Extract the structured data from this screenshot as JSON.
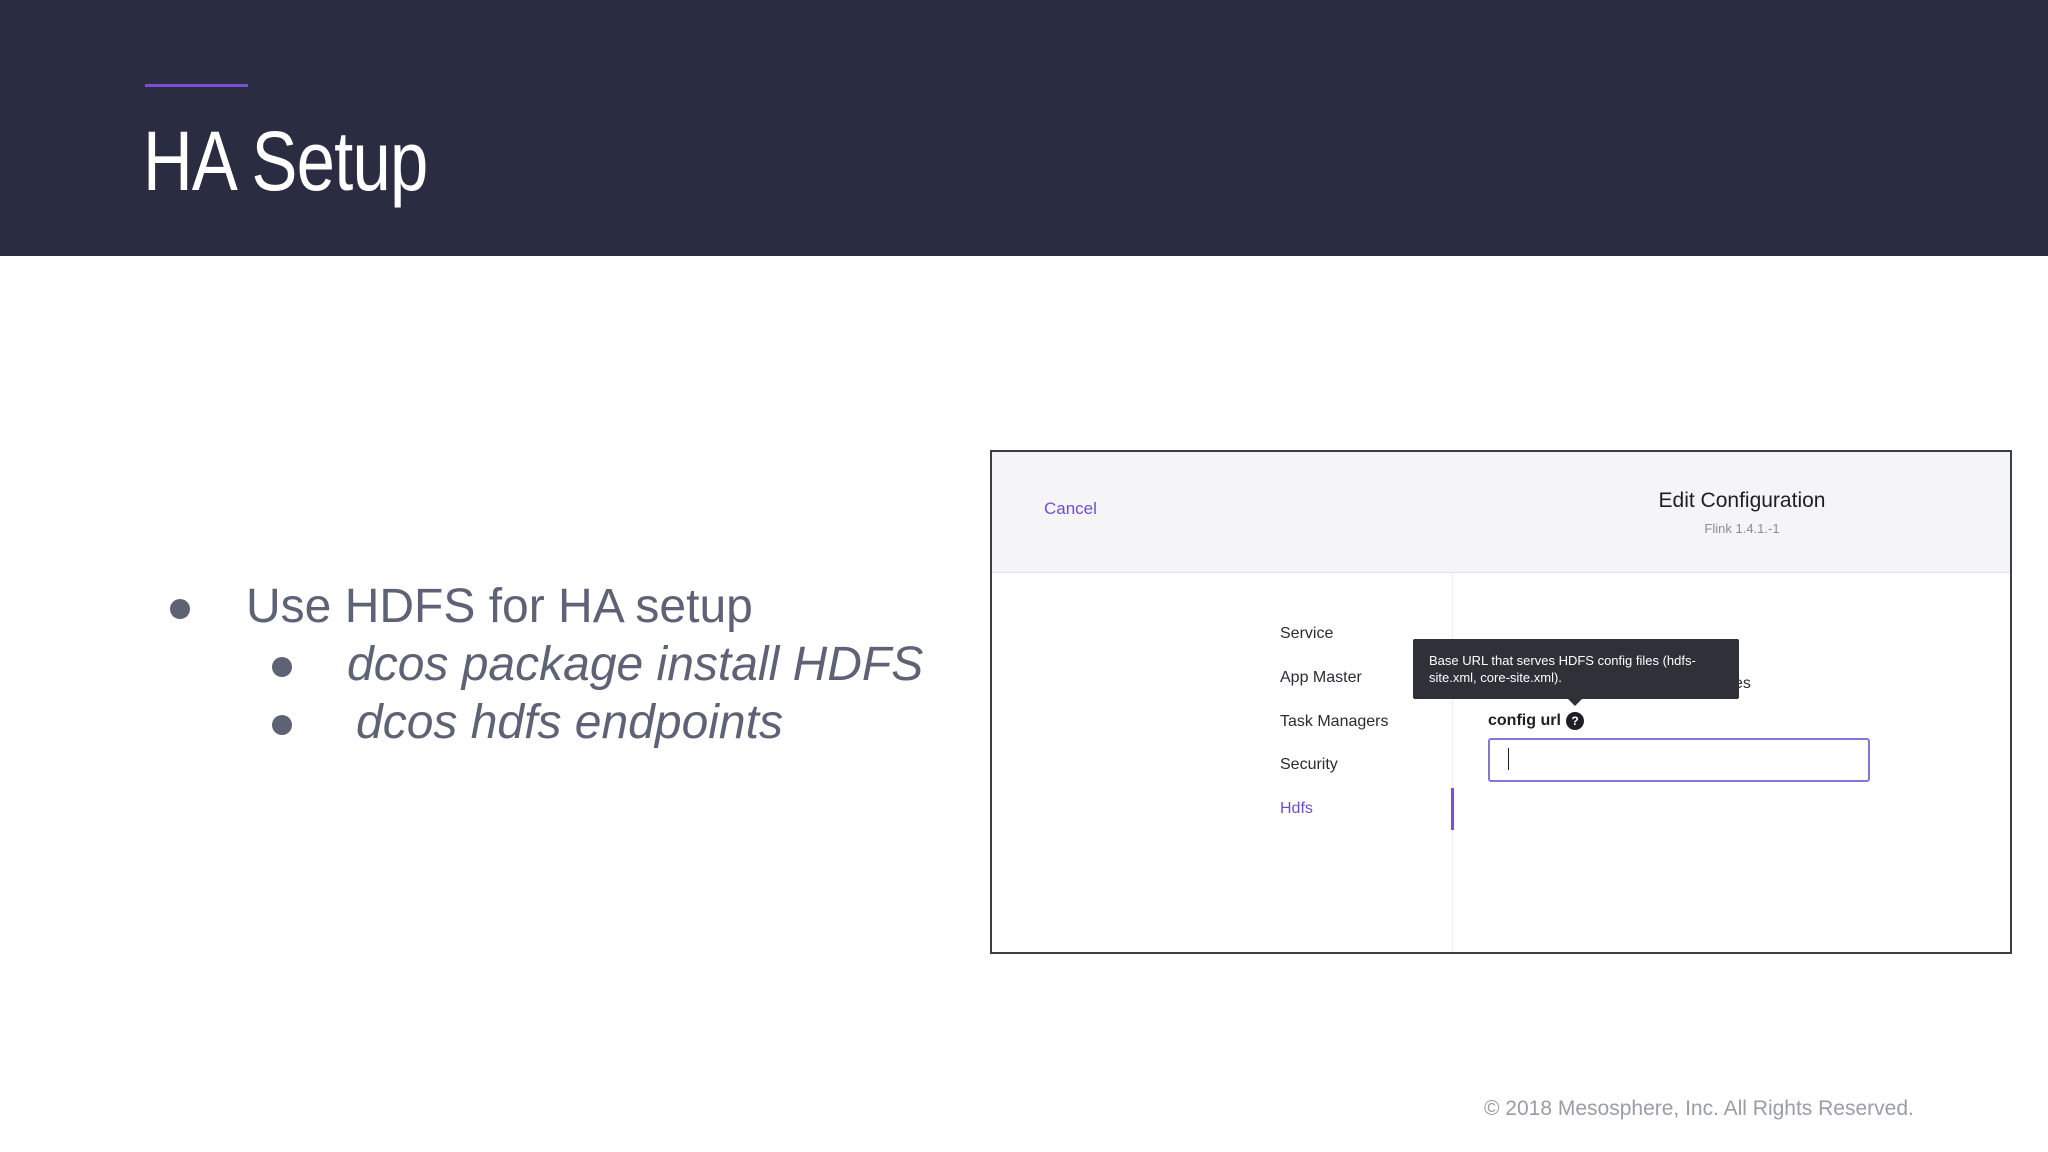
{
  "slide": {
    "title": "HA Setup",
    "bullets": [
      "Use HDFS for HA setup",
      "dcos package install HDFS",
      " dcos hdfs endpoints"
    ],
    "copyright": "© 2018 Mesosphere, Inc. All Rights Reserved."
  },
  "colors": {
    "header_bg": "#2a2d41",
    "accent": "#7a4fd6",
    "link": "#6b4fd1"
  },
  "modal": {
    "cancel_label": "Cancel",
    "title": "Edit Configuration",
    "subtitle": "Flink 1.4.1.-1",
    "nav": [
      {
        "label": "Service"
      },
      {
        "label": "App Master"
      },
      {
        "label": "Task Managers"
      },
      {
        "label": "Security"
      },
      {
        "label": "Hdfs",
        "active": true
      }
    ],
    "ghost_text": "es",
    "tooltip": "Base URL that serves HDFS config files (hdfs-site.xml, core-site.xml).",
    "field_label": "config url",
    "help_icon": "question-circle-icon",
    "help_glyph": "?",
    "input_value": ""
  }
}
